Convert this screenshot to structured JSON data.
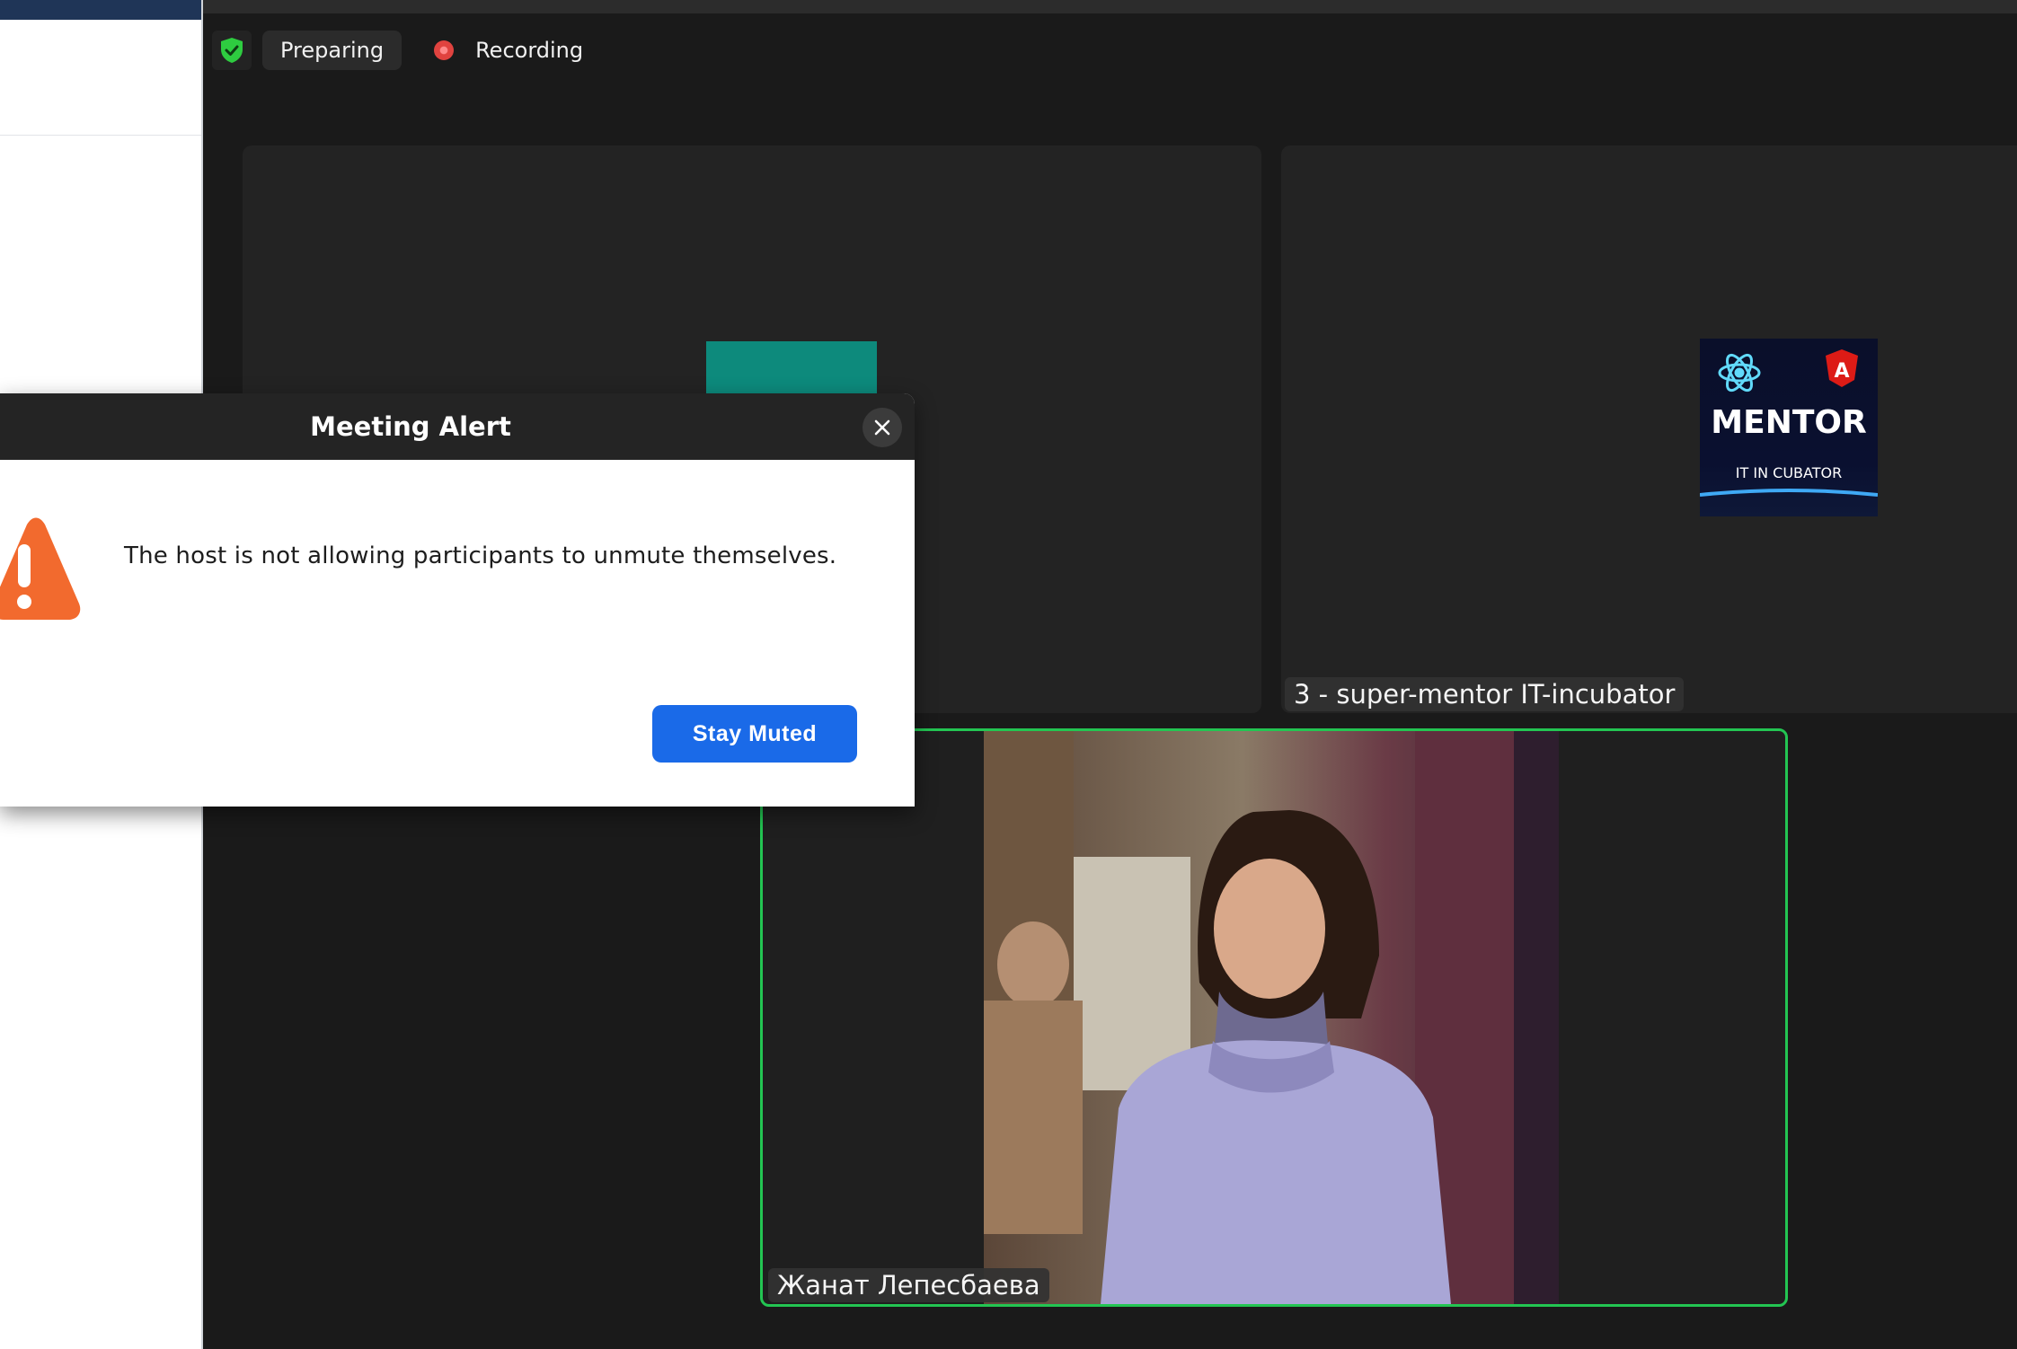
{
  "status": {
    "preparing_label": "Preparing",
    "recording_label": "Recording"
  },
  "tiles": [
    {
      "name": ""
    },
    {
      "name": "3 - super-mentor IT-incubator",
      "logo_text": "MENTOR",
      "logo_subtext": "IT IN CUBATOR"
    }
  ],
  "speaker": {
    "name": "Жанат Лепесбаева"
  },
  "dialog": {
    "title": "Meeting Alert",
    "message": "The host is not allowing participants to unmute themselves.",
    "button_label": "Stay Muted"
  },
  "colors": {
    "speaker_border": "#23c552",
    "button": "#1a6ae8",
    "warning": "#f26a2e",
    "shield": "#2ecc40"
  },
  "icons": [
    "shield-check-icon",
    "record-dot-icon",
    "close-icon",
    "warning-icon"
  ]
}
